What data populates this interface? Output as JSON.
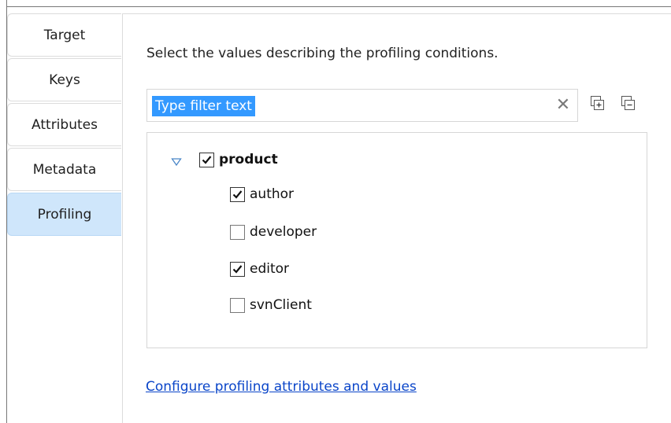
{
  "tabs": [
    {
      "label": "Target",
      "active": false
    },
    {
      "label": "Keys",
      "active": false
    },
    {
      "label": "Attributes",
      "active": false
    },
    {
      "label": "Metadata",
      "active": false
    },
    {
      "label": "Profiling",
      "active": true
    }
  ],
  "panel": {
    "description": "Select the values describing the profiling conditions.",
    "filter": {
      "placeholder": "Type filter text",
      "selected_text": "Type filter text",
      "clear_icon": "clear-icon"
    },
    "toolbar": {
      "expand_all_icon": "expand-all-icon",
      "collapse_all_icon": "collapse-all-icon"
    },
    "tree": {
      "root": {
        "label": "product",
        "checked": true,
        "expanded": true
      },
      "children": [
        {
          "label": "author",
          "checked": true
        },
        {
          "label": "developer",
          "checked": false
        },
        {
          "label": "editor",
          "checked": true
        },
        {
          "label": "svnClient",
          "checked": false
        }
      ]
    },
    "link": "Configure profiling attributes and values"
  },
  "colors": {
    "active_tab": "#cfe6fb",
    "selection": "#3399ff",
    "link": "#0a45c9"
  }
}
